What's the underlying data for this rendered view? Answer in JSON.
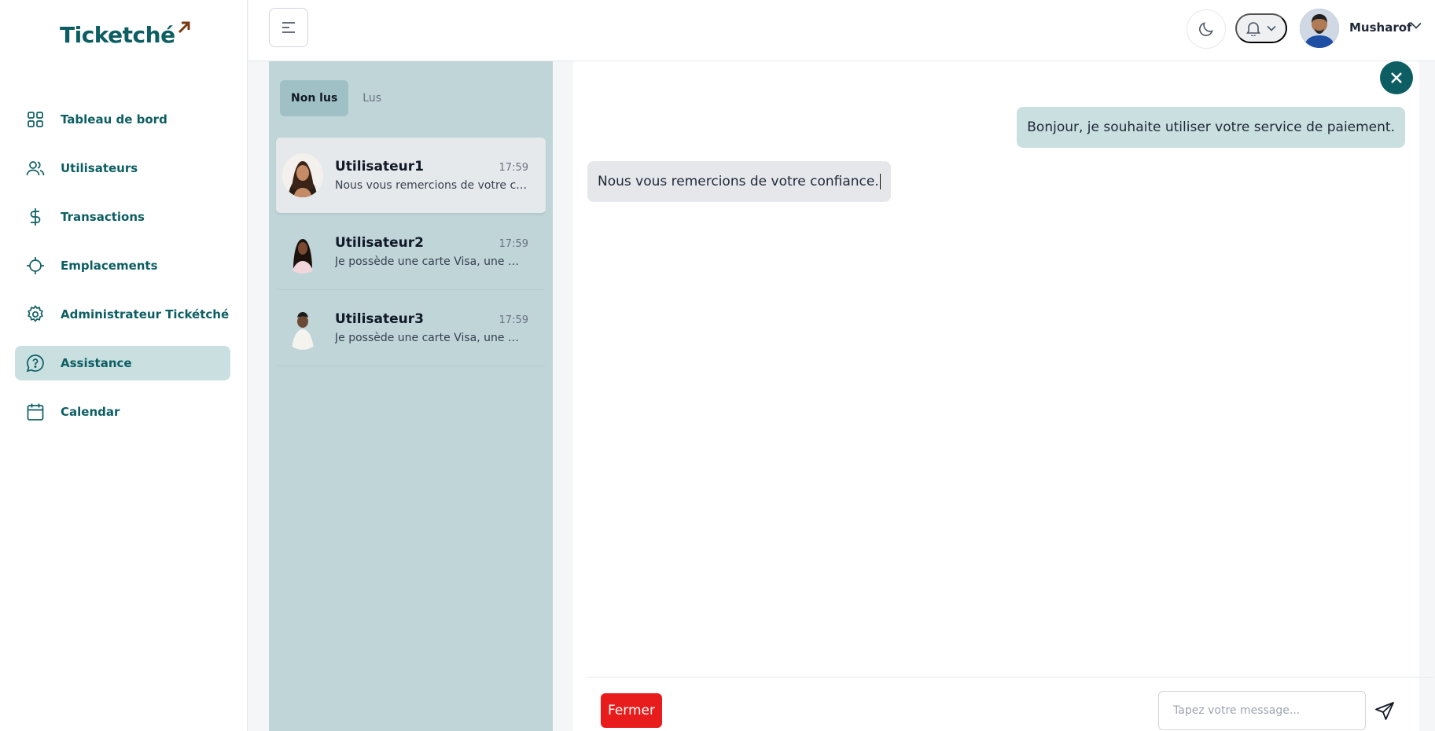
{
  "app": {
    "logo_text": "Ticketché",
    "brand_color": "#0d5e63",
    "accent_color": "#7a3b12"
  },
  "sidebar": {
    "items": [
      {
        "label": "Tableau de bord",
        "icon": "dashboard-grid-icon",
        "active": false
      },
      {
        "label": "Utilisateurs",
        "icon": "users-icon",
        "active": false
      },
      {
        "label": "Transactions",
        "icon": "dollar-icon",
        "active": false
      },
      {
        "label": "Emplacements",
        "icon": "location-crosshair-icon",
        "active": false
      },
      {
        "label": "Administrateur Tickétché",
        "icon": "gear-icon",
        "active": false
      },
      {
        "label": "Assistance",
        "icon": "chat-help-icon",
        "active": true
      },
      {
        "label": "Calendar",
        "icon": "calendar-icon",
        "active": false
      }
    ]
  },
  "header": {
    "menu_icon": "hamburger-menu-icon",
    "theme_icon": "moon-icon",
    "notification_icon": "bell-icon",
    "user_name": "Musharof"
  },
  "conversations": {
    "tabs": [
      {
        "label": "Non lus",
        "active": true
      },
      {
        "label": "Lus",
        "active": false
      }
    ],
    "items": [
      {
        "name": "Utilisateur1",
        "time": "17:59",
        "preview": "Nous vous remercions de votre confiance.",
        "active": true
      },
      {
        "name": "Utilisateur2",
        "time": "17:59",
        "preview": "Je possède une carte Visa, une MasterCard",
        "active": false
      },
      {
        "name": "Utilisateur3",
        "time": "17:59",
        "preview": "Je possède une carte Visa, une MasterCard",
        "active": false
      }
    ]
  },
  "chat": {
    "messages": [
      {
        "direction": "outgoing",
        "text": "Bonjour, je souhaite utiliser votre service de paiement."
      },
      {
        "direction": "incoming",
        "text": "Nous vous remercions de votre confiance."
      }
    ],
    "close_button_label": "Fermer",
    "input_placeholder": "Tapez votre message...",
    "send_icon": "send-paper-plane-icon",
    "close_chat_icon": "close-icon"
  }
}
